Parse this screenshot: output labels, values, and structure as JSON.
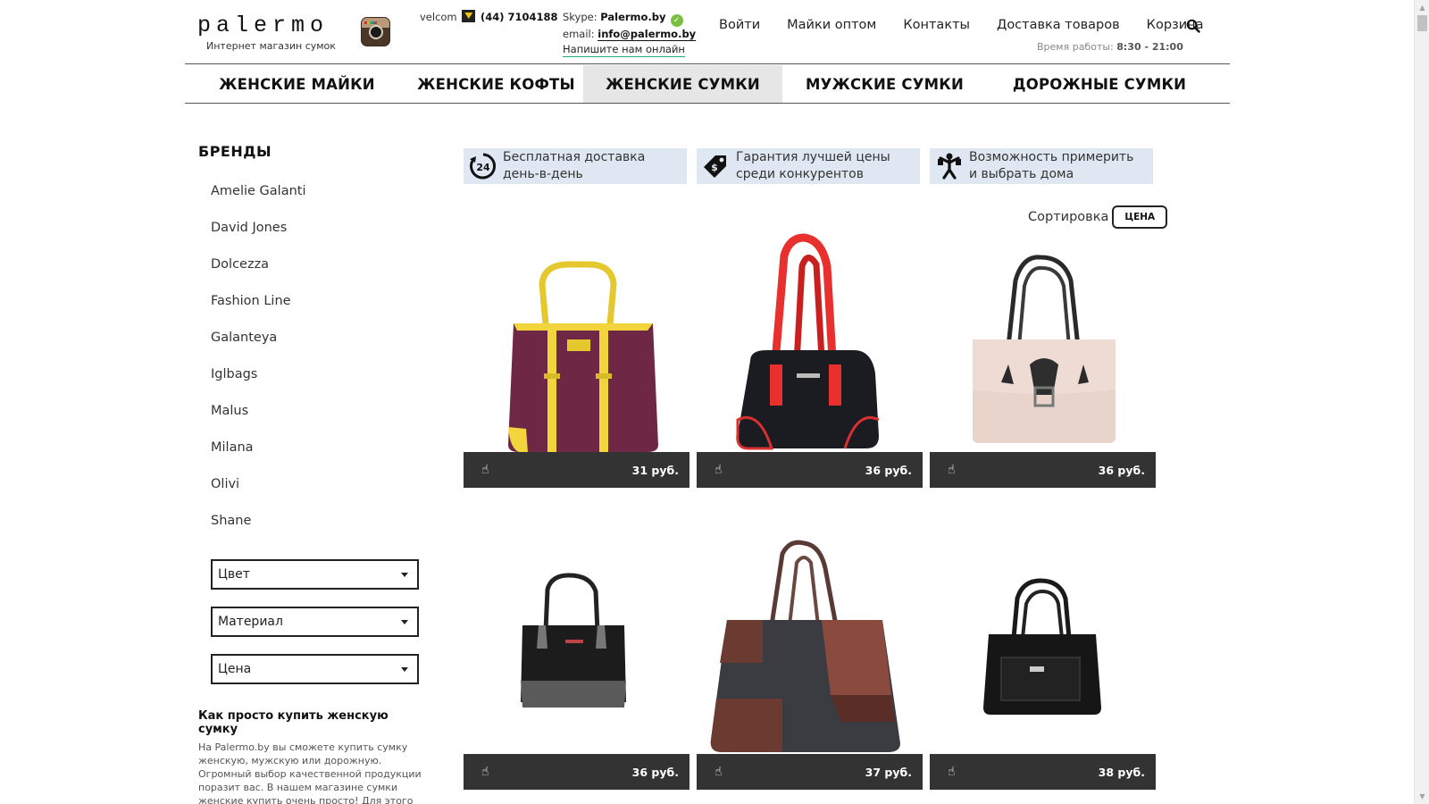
{
  "header": {
    "logo_text": "palermo",
    "logo_sub": "Интернет магазин сумок",
    "phone_label": "velcom",
    "phone_number": "(44) 7104188",
    "skype_label": "Skype:",
    "skype_value": "Palermo.by",
    "email_label": "email:",
    "email_value": "info@palermo.by",
    "write_link": "Напишите нам онлайн",
    "nav": [
      "Войти",
      "Майки оптом",
      "Контакты",
      "Доставка товаров",
      "Корзина"
    ],
    "hours_label": "Время работы:",
    "hours_value": "8:30 - 21:00"
  },
  "categories": [
    {
      "label": "ЖЕНСКИЕ МАЙКИ",
      "active": false
    },
    {
      "label": "ЖЕНСКИЕ КОФТЫ",
      "active": false
    },
    {
      "label": "ЖЕНСКИЕ СУМКИ",
      "active": true
    },
    {
      "label": "МУЖСКИЕ СУМКИ",
      "active": false
    },
    {
      "label": "ДОРОЖНЫЕ СУМКИ",
      "active": false
    }
  ],
  "sidebar": {
    "brands_title": "БРЕНДЫ",
    "brands": [
      "Amelie Galanti",
      "David Jones",
      "Dolcezza",
      "Fashion Line",
      "Galanteya",
      "Iglbags",
      "Malus",
      "Milana",
      "Olivi",
      "Shane"
    ],
    "filters": [
      "Цвет",
      "Материал",
      "Цена"
    ],
    "how_title": "Как просто купить женскую сумку",
    "how_text": "На Palermo.by вы сможете купить сумку женскую, мужскую или дорожную. Огромный выбор качественной продукции поразит вас. В нашем магазине сумки женские купить очень просто! Для этого нужно кликнуть на"
  },
  "perks": [
    {
      "icon": "delivery-24-icon",
      "line1": "Бесплатная доставка",
      "line2": "день-в-день"
    },
    {
      "icon": "price-tag-icon",
      "line1": "Гарантия лучшей цены",
      "line2": "среди конкурентов"
    },
    {
      "icon": "try-on-icon",
      "line1": "Возможность примерить",
      "line2": "и выбрать дома"
    }
  ],
  "sort": {
    "label": "Сортировка",
    "button": "ЦЕНА"
  },
  "products": [
    {
      "price": "31 руб.",
      "image": "purple-yellow-tote-bag"
    },
    {
      "price": "36 руб.",
      "image": "black-red-handle-bag"
    },
    {
      "price": "36 руб.",
      "image": "beige-satchel-bag"
    },
    {
      "price": "36 руб.",
      "image": "black-small-tote-bag"
    },
    {
      "price": "37 руб.",
      "image": "brown-patchwork-bag"
    },
    {
      "price": "38 руб.",
      "image": "black-leather-handbag"
    }
  ]
}
